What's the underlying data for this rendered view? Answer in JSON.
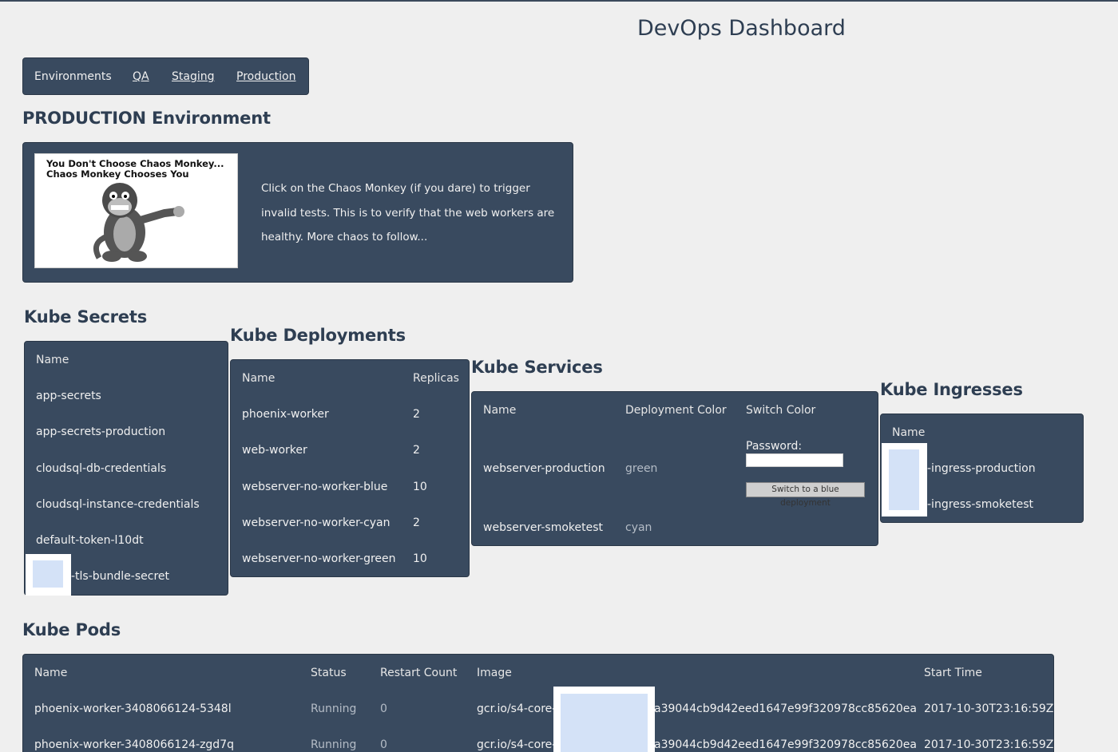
{
  "header": {
    "title": "DevOps Dashboard"
  },
  "nav": {
    "label": "Environments",
    "links": [
      "QA",
      "Staging",
      "Production"
    ]
  },
  "env_heading": "PRODUCTION Environment",
  "chaos": {
    "image_caption_1": "You Don't Choose Chaos Monkey...",
    "image_caption_2": "Chaos Monkey Chooses You",
    "text": "Click on the Chaos Monkey (if you dare) to trigger invalid tests. This is to verify that the web workers are healthy. More chaos to follow..."
  },
  "secrets": {
    "heading": "Kube Secrets",
    "col_name": "Name",
    "rows": [
      "app-secrets",
      "app-secrets-production",
      "cloudsql-db-credentials",
      "cloudsql-instance-credentials",
      "default-token-l10dt",
      "-tls-bundle-secret"
    ]
  },
  "deployments": {
    "heading": "Kube Deployments",
    "col_name": "Name",
    "col_replicas": "Replicas",
    "rows": [
      {
        "name": "phoenix-worker",
        "replicas": "2"
      },
      {
        "name": "web-worker",
        "replicas": "2"
      },
      {
        "name": "webserver-no-worker-blue",
        "replicas": "10"
      },
      {
        "name": "webserver-no-worker-cyan",
        "replicas": "2"
      },
      {
        "name": "webserver-no-worker-green",
        "replicas": "10"
      }
    ]
  },
  "services": {
    "heading": "Kube Services",
    "col_name": "Name",
    "col_color": "Deployment Color",
    "col_switch": "Switch Color",
    "password_label": "Password:",
    "switch_button": "Switch to a blue deployment",
    "rows": [
      {
        "name": "webserver-production",
        "color": "green"
      },
      {
        "name": "webserver-smoketest",
        "color": "cyan"
      }
    ]
  },
  "ingresses": {
    "heading": "Kube Ingresses",
    "col_name": "Name",
    "rows": [
      "-ingress-production",
      "-ingress-smoketest"
    ]
  },
  "pods": {
    "heading": "Kube Pods",
    "col_name": "Name",
    "col_status": "Status",
    "col_restarts": "Restart Count",
    "col_image": "Image",
    "col_start": "Start Time",
    "rows": [
      {
        "name": "phoenix-worker-3408066124-5348l",
        "status": "Running",
        "restarts": "0",
        "image_prefix": "gcr.io/s4-core-",
        "image_suffix": "a39044cb9d42eed1647e99f320978cc85620ea",
        "start": "2017-10-30T23:16:59Z"
      },
      {
        "name": "phoenix-worker-3408066124-zgd7q",
        "status": "Running",
        "restarts": "0",
        "image_prefix": "gcr.io/s4-core-",
        "image_suffix": "a39044cb9d42eed1647e99f320978cc85620ea",
        "start": "2017-10-30T23:16:59Z"
      }
    ]
  }
}
